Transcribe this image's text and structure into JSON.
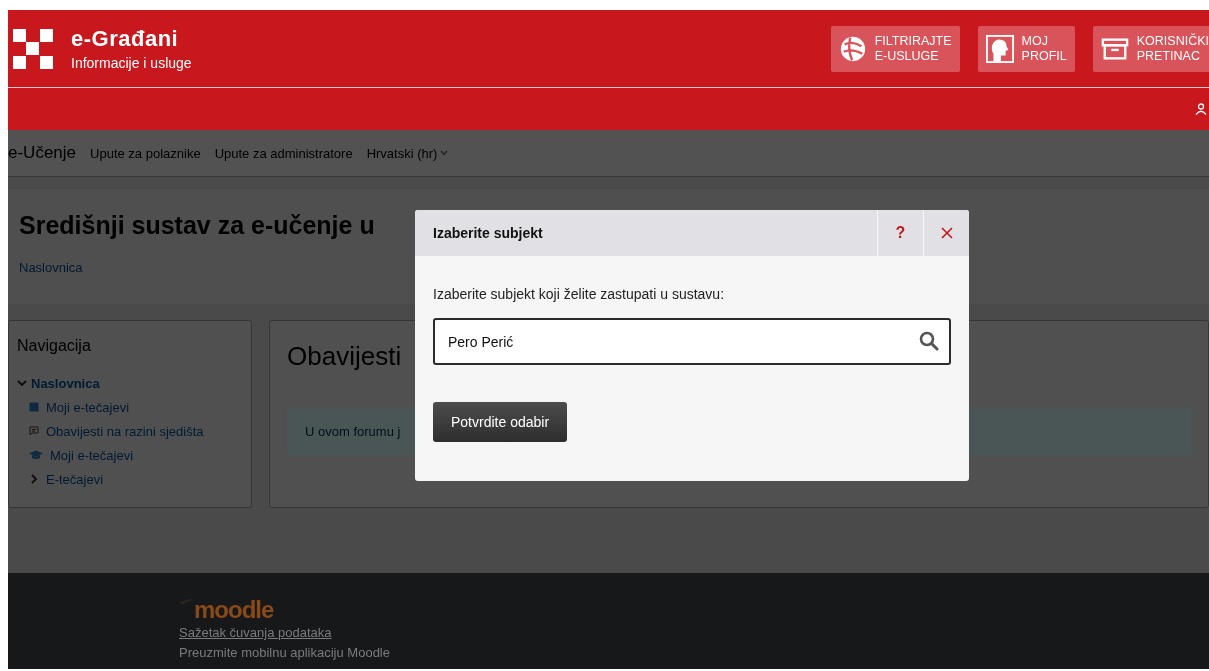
{
  "header": {
    "title": "e-Građani",
    "subtitle": "Informacije i usluge",
    "buttons": [
      {
        "kind": "filter",
        "lines": [
          "FILTRIRAJTE",
          "E-USLUGE"
        ]
      },
      {
        "kind": "profile",
        "lines": [
          "MOJ",
          "PROFIL"
        ]
      },
      {
        "kind": "inbox",
        "lines": [
          "KORISNIČKI",
          "PRETINAC"
        ]
      }
    ]
  },
  "navbar": {
    "brand": "e-Učenje",
    "links": [
      "Upute za polaznike",
      "Upute za administratore"
    ],
    "language": "Hrvatski (hr)"
  },
  "page_header": {
    "title": "Središnji sustav za e-učenje u",
    "breadcrumb": "Naslovnica"
  },
  "navigation": {
    "title": "Navigacija",
    "items": [
      {
        "kind": "branch",
        "label": "Naslovnica",
        "expanded": true,
        "children": [
          {
            "kind": "page",
            "label": "Moji e-tečajevi"
          },
          {
            "kind": "forum",
            "label": "Obavijesti na razini sjedišta"
          },
          {
            "kind": "courses",
            "label": "Moji e-tečajevi"
          },
          {
            "kind": "branch",
            "label": "E-tečajevi",
            "expanded": false
          }
        ]
      }
    ]
  },
  "main": {
    "heading": "Obavijesti",
    "alert": "U ovom forumu j"
  },
  "footer": {
    "logo": "moodle",
    "links": [
      "Sažetak čuvanja podataka",
      "Preuzmite mobilnu aplikaciju Moodle"
    ]
  },
  "modal": {
    "title": "Izaberite subjekt",
    "help": "?",
    "label": "Izaberite subjekt koji želite zastupati u sustavu:",
    "search_value": "Pero Perić",
    "confirm": "Potvrdite odabir"
  }
}
